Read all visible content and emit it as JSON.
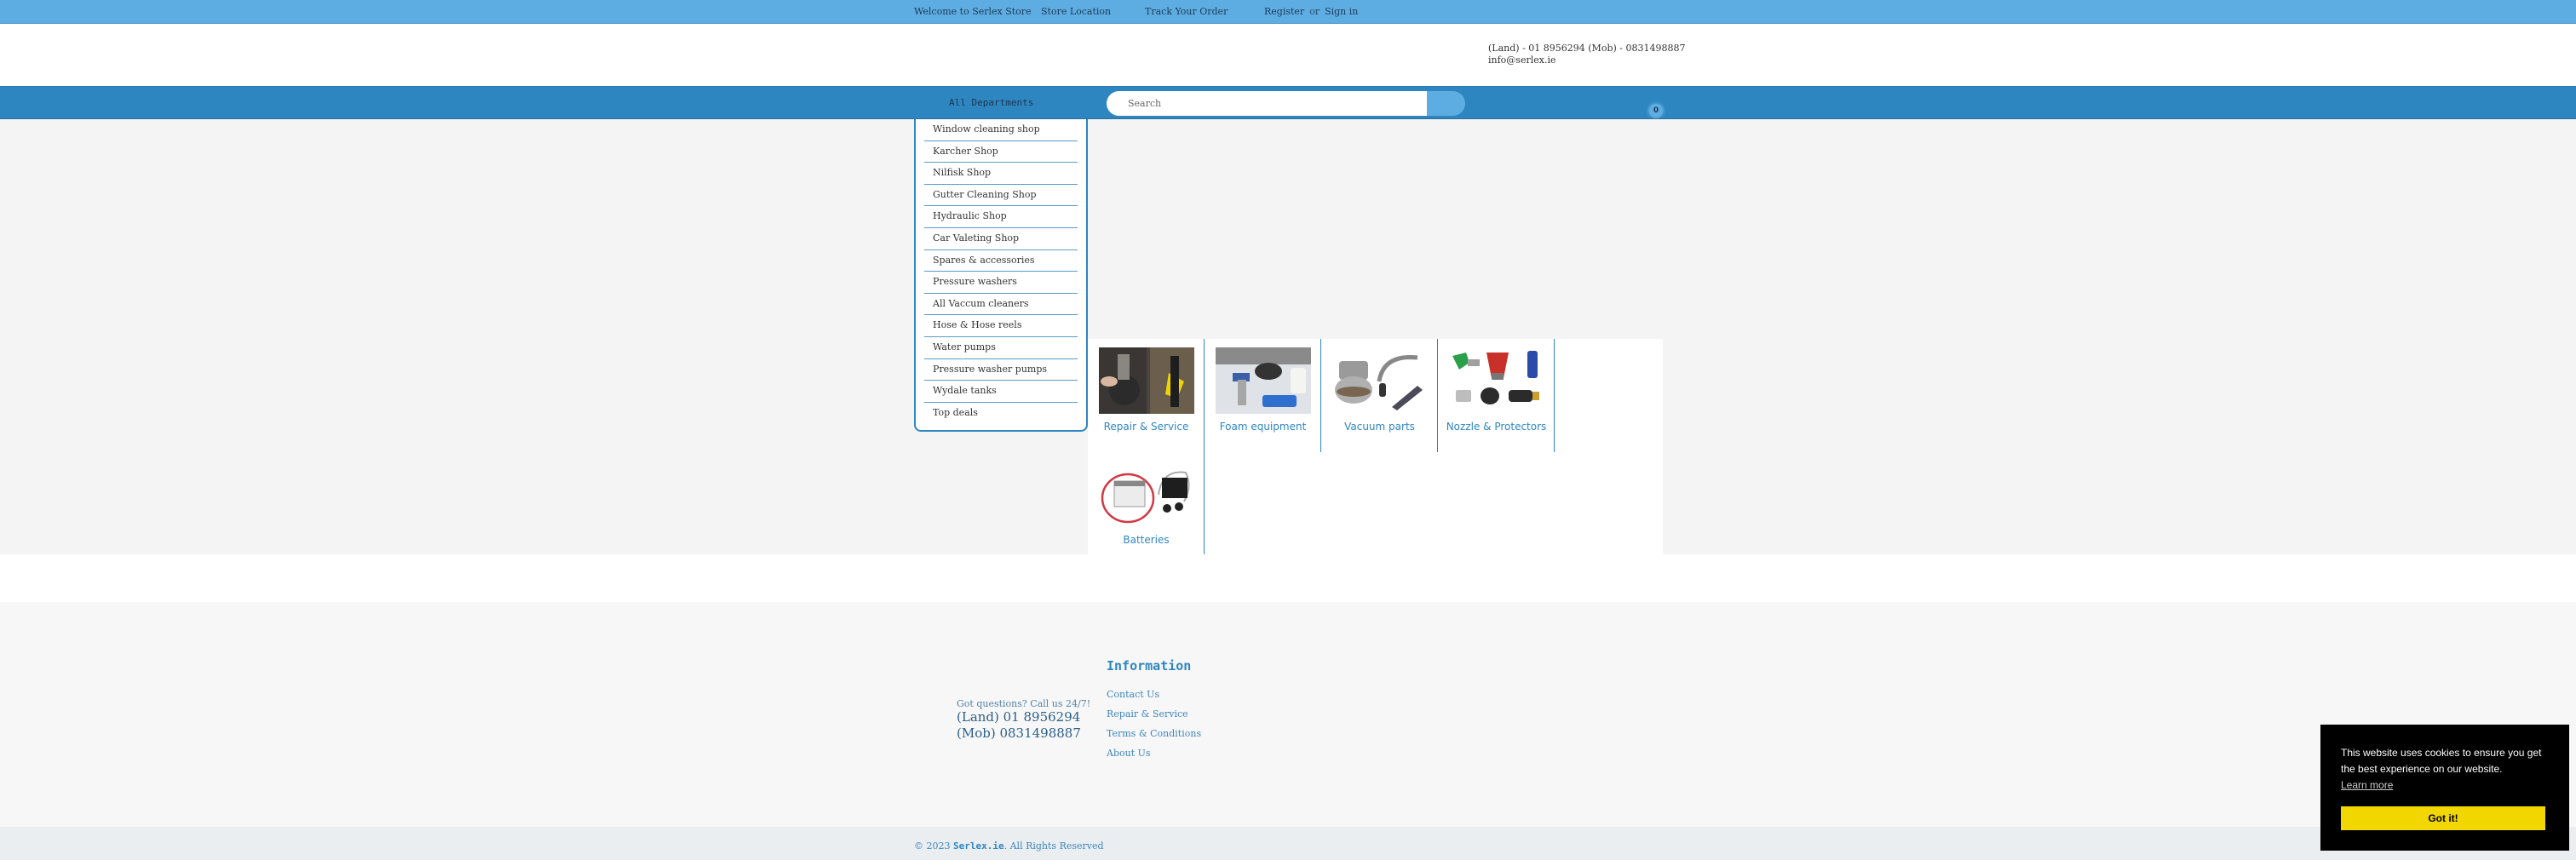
{
  "topbar": {
    "welcome": "Welcome to Serlex Store",
    "store_location": "Store Location",
    "track_order": "Track Your Order",
    "register": "Register",
    "or": "or",
    "sign_in": "Sign in"
  },
  "header": {
    "contact_phones": "(Land) - 01 8956294 (Mob) - 0831498887",
    "contact_email": "info@serlex.ie"
  },
  "nav": {
    "departments_label": "All Departments",
    "search_placeholder": "Search",
    "cart_count": "0"
  },
  "departments": [
    "Window cleaning shop",
    "Karcher Shop",
    "Nilfisk Shop",
    "Gutter Cleaning Shop",
    "Hydraulic Shop",
    "Car Valeting Shop",
    "Spares & accessories",
    "Pressure washers",
    "All Vaccum cleaners",
    "Hose & Hose reels",
    "Water pumps",
    "Pressure washer pumps",
    "Wydale tanks",
    "Top deals"
  ],
  "categories": [
    {
      "label": "Repair & Service",
      "icon": "repair-photo"
    },
    {
      "label": "Foam equipment",
      "icon": "foam-photo"
    },
    {
      "label": "Vacuum parts",
      "icon": "vacuum-parts-photo"
    },
    {
      "label": "Nozzle & Protectors",
      "icon": "nozzle-photo"
    },
    {
      "label": "Batteries",
      "icon": "batteries-photo"
    }
  ],
  "footer": {
    "call_prompt": "Got questions? Call us 24/7!",
    "land_phone": "(Land) 01 8956294",
    "mob_phone": "(Mob) 0831498887",
    "info_title": "Information",
    "info_links": [
      "Contact Us",
      "Repair & Service",
      "Terms & Conditions",
      "About Us"
    ],
    "copyright_prefix": "© 2023 ",
    "copyright_brand": "Serlex.ie",
    "copyright_suffix": ". All Rights Reserved"
  },
  "cookie": {
    "message": "This website uses cookies to ensure you get the best experience on our website.",
    "learn_more": "Learn more",
    "accept": "Got it!"
  },
  "colors": {
    "topbar": "#5dade2",
    "navbar": "#2e86c1",
    "accent": "#2e86c1",
    "cookie_button": "#f1d600"
  }
}
